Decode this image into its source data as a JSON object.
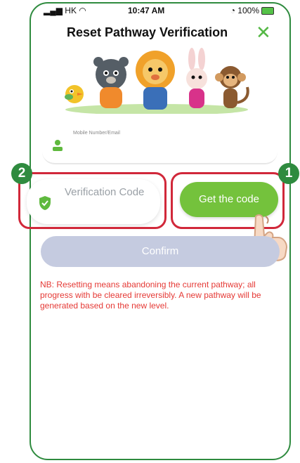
{
  "status_bar": {
    "carrier": "HK",
    "time": "10:47 AM",
    "battery": "100%"
  },
  "header": {
    "title": "Reset Pathway Verification",
    "close_icon": "close-x-icon"
  },
  "form": {
    "mobile_label": "Mobile Number/Email",
    "verification_placeholder": "Verification Code",
    "get_code_label": "Get the code",
    "confirm_label": "Confirm"
  },
  "callouts": {
    "step1": "1",
    "step2": "2"
  },
  "note": "NB: Resetting means abandoning the current pathway; all progress with be cleared irreversibly. A new pathway will be generated based on the new level.",
  "colors": {
    "accent_green": "#74c23c",
    "callout_red": "#d1283a",
    "note_red": "#e53935",
    "confirm_disabled": "#c5cbe0"
  }
}
